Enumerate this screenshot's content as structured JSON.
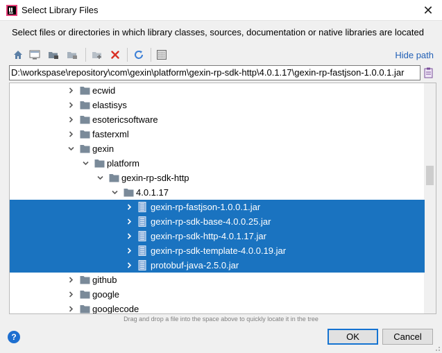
{
  "window": {
    "title": "Select Library Files",
    "close_glyph": "✕"
  },
  "description": "Select files or directories in which library classes, sources, documentation or native libraries are located",
  "toolbar": {
    "icons": [
      "home-icon",
      "desktop-icon",
      "project-folder-icon",
      "module-folder-icon",
      "new-folder-icon",
      "delete-icon",
      "refresh-icon",
      "show-hidden-icon"
    ],
    "hide_path_label": "Hide path"
  },
  "path": {
    "value": "D:\\workspase\\repository\\com\\gexin\\platform\\gexin-rp-sdk-http\\4.0.1.17\\gexin-rp-fastjson-1.0.0.1.jar"
  },
  "tree": {
    "rows": [
      {
        "label": "ecwid",
        "type": "folder",
        "depth": 0,
        "expanded": false,
        "selected": false
      },
      {
        "label": "elastisys",
        "type": "folder",
        "depth": 0,
        "expanded": false,
        "selected": false
      },
      {
        "label": "esotericsoftware",
        "type": "folder",
        "depth": 0,
        "expanded": false,
        "selected": false
      },
      {
        "label": "fasterxml",
        "type": "folder",
        "depth": 0,
        "expanded": false,
        "selected": false
      },
      {
        "label": "gexin",
        "type": "folder",
        "depth": 0,
        "expanded": true,
        "selected": false
      },
      {
        "label": "platform",
        "type": "folder",
        "depth": 1,
        "expanded": true,
        "selected": false
      },
      {
        "label": "gexin-rp-sdk-http",
        "type": "folder",
        "depth": 2,
        "expanded": true,
        "selected": false
      },
      {
        "label": "4.0.1.17",
        "type": "folder",
        "depth": 3,
        "expanded": true,
        "selected": false
      },
      {
        "label": "gexin-rp-fastjson-1.0.0.1.jar",
        "type": "jar",
        "depth": 4,
        "expanded": false,
        "selected": true
      },
      {
        "label": "gexin-rp-sdk-base-4.0.0.25.jar",
        "type": "jar",
        "depth": 4,
        "expanded": false,
        "selected": true
      },
      {
        "label": "gexin-rp-sdk-http-4.0.1.17.jar",
        "type": "jar",
        "depth": 4,
        "expanded": false,
        "selected": true
      },
      {
        "label": "gexin-rp-sdk-template-4.0.0.19.jar",
        "type": "jar",
        "depth": 4,
        "expanded": false,
        "selected": true
      },
      {
        "label": "protobuf-java-2.5.0.jar",
        "type": "jar",
        "depth": 4,
        "expanded": false,
        "selected": true
      },
      {
        "label": "github",
        "type": "folder",
        "depth": 0,
        "expanded": false,
        "selected": false
      },
      {
        "label": "google",
        "type": "folder",
        "depth": 0,
        "expanded": false,
        "selected": false
      },
      {
        "label": "googlecode",
        "type": "folder",
        "depth": 0,
        "expanded": false,
        "selected": false
      }
    ]
  },
  "hint": "Drag and drop a file into the space above to quickly locate it in the tree",
  "buttons": {
    "help": "?",
    "ok": "OK",
    "cancel": "Cancel"
  },
  "colors": {
    "selection": "#1a73c0",
    "link": "#2260b6",
    "folder": "#7a8a99",
    "help": "#1e6fd0"
  }
}
